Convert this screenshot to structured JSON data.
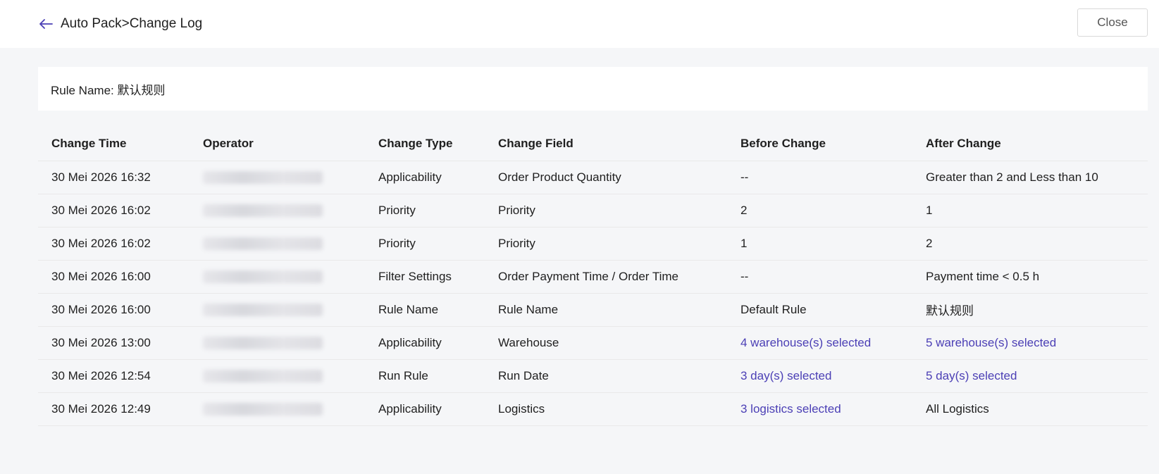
{
  "header": {
    "title": "Auto Pack>Change Log",
    "close_label": "Close"
  },
  "rule": {
    "label": "Rule Name: 默认规则"
  },
  "table": {
    "columns": [
      "Change Time",
      "Operator",
      "Change Type",
      "Change Field",
      "Before Change",
      "After Change"
    ],
    "rows": [
      {
        "time": "30 Mei 2026 16:32",
        "type": "Applicability",
        "field": "Order Product Quantity",
        "before": "--",
        "after": "Greater than 2 and Less than 10"
      },
      {
        "time": "30 Mei 2026 16:02",
        "type": "Priority",
        "field": "Priority",
        "before": "2",
        "after": "1"
      },
      {
        "time": "30 Mei 2026 16:02",
        "type": "Priority",
        "field": "Priority",
        "before": "1",
        "after": "2"
      },
      {
        "time": "30 Mei 2026 16:00",
        "type": "Filter Settings",
        "field": "Order Payment Time / Order Time",
        "before": "--",
        "after": "Payment time < 0.5 h"
      },
      {
        "time": "30 Mei 2026 16:00",
        "type": "Rule Name",
        "field": "Rule Name",
        "before": "Default Rule",
        "after": "默认规则"
      },
      {
        "time": "30 Mei 2026 13:00",
        "type": "Applicability",
        "field": "Warehouse",
        "before": "4 warehouse(s) selected",
        "after": "5 warehouse(s) selected"
      },
      {
        "time": "30 Mei 2026 12:54",
        "type": "Run Rule",
        "field": "Run Date",
        "before": "3 day(s) selected",
        "after": "5 day(s) selected"
      },
      {
        "time": "30 Mei 2026 12:49",
        "type": "Applicability",
        "field": "Logistics",
        "before": "3 logistics selected",
        "after": "All Logistics"
      }
    ]
  },
  "colors": {
    "link": "#4b3fb5",
    "back_arrow": "#4b3fb5"
  }
}
